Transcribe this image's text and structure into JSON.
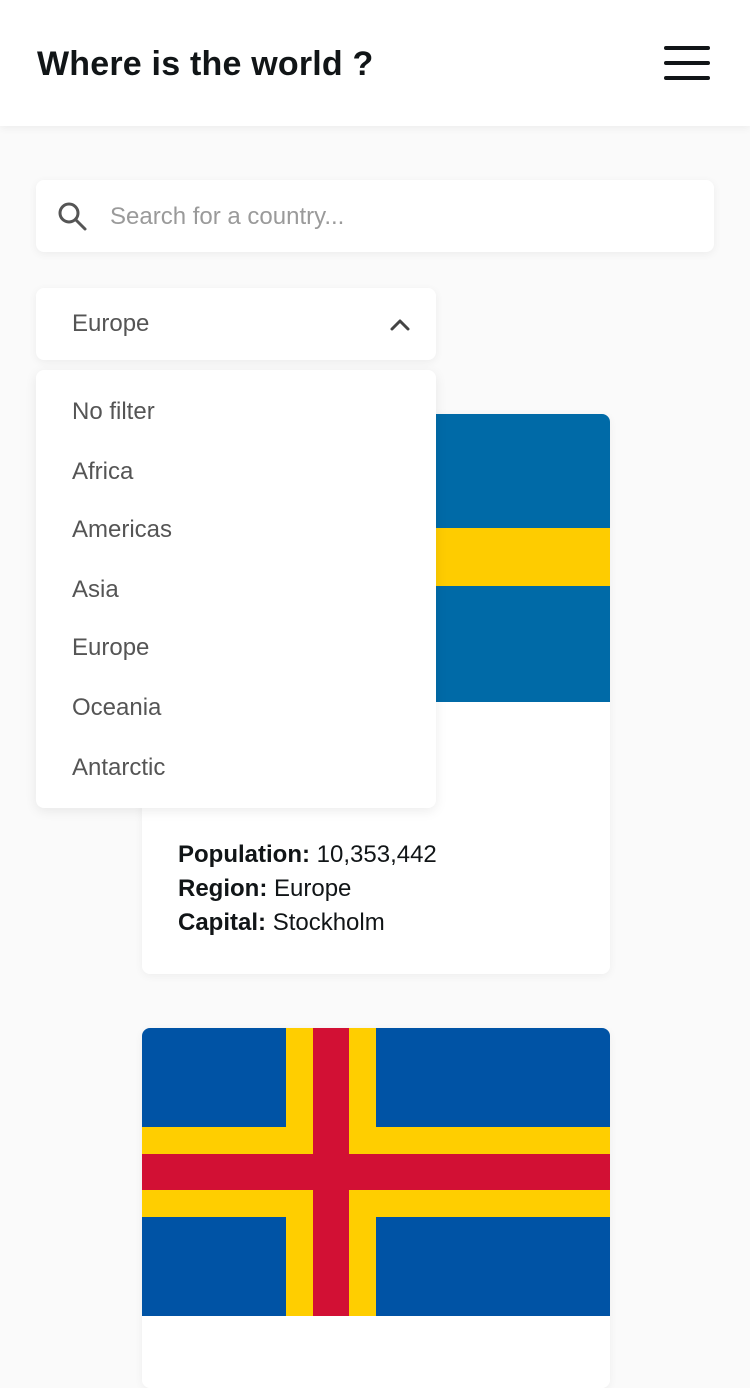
{
  "header": {
    "title": "Where is the world ?",
    "menu_icon": "hamburger-menu-icon"
  },
  "search": {
    "placeholder": "Search for a country...",
    "value": "",
    "icon": "search-icon"
  },
  "filter": {
    "selected": "Europe",
    "icon": "chevron-up-icon",
    "options": [
      "No filter",
      "Africa",
      "Americas",
      "Asia",
      "Europe",
      "Oceania",
      "Antarctic"
    ]
  },
  "countries": [
    {
      "flag_colors": {
        "field": "#006aa7",
        "cross": "#fecc00"
      },
      "population_label": "Population:",
      "population": "10,353,442",
      "region_label": "Region:",
      "region": "Europe",
      "capital_label": "Capital:",
      "capital": "Stockholm"
    },
    {
      "flag_colors": {
        "field": "#0053a5",
        "outer_cross": "#ffce00",
        "inner_cross": "#d21034"
      }
    }
  ]
}
